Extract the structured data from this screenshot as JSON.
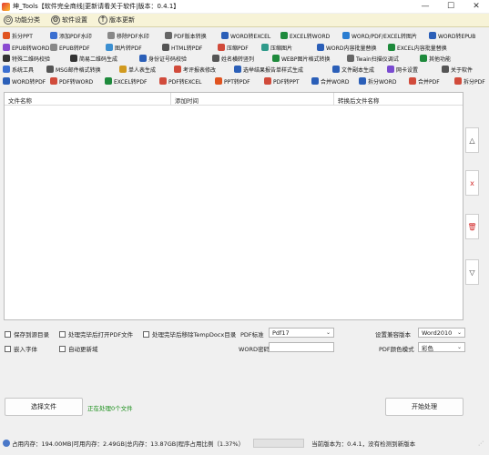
{
  "window": {
    "title": "坤_Tools【软件完全商线|更新请看关于软件|版本：0.4.1】",
    "minimize": "—",
    "maximize": "☐",
    "close": "✕"
  },
  "menu": [
    {
      "label": "功能分类",
      "icon": "⊙"
    },
    {
      "label": "软件设置",
      "icon": "⚙"
    },
    {
      "label": "版本更新",
      "icon": "↑"
    }
  ],
  "toolbar_rows": [
    [
      {
        "label": "拆分PPT",
        "color": "#e0531f"
      },
      {
        "label": "添加PDF水印",
        "color": "#3b6fd1"
      },
      {
        "label": "移除PDF水印",
        "color": "#888888"
      },
      {
        "label": "PDF版本转换",
        "color": "#666666"
      },
      {
        "label": "WORD转EXCEL",
        "color": "#2b5fb8"
      },
      {
        "label": "EXCEL转WORD",
        "color": "#1e8a3c"
      },
      {
        "label": "WORD/PDF/EXCEL转图片",
        "color": "#2a7dd1"
      },
      {
        "label": "WORD转EPUB",
        "color": "#2b5fb8"
      }
    ],
    [
      {
        "label": "EPUB转WORD",
        "color": "#8a4bd1"
      },
      {
        "label": "EPUB转PDF",
        "color": "#888888"
      },
      {
        "label": "图片转PDF",
        "color": "#3b8fd1"
      },
      {
        "label": "HTML转PDF",
        "color": "#555555"
      },
      {
        "label": "压缩PDF",
        "color": "#d14b3b"
      },
      {
        "label": "压缩图片",
        "color": "#2f9a8a"
      },
      {
        "label": "WORD内容批量替换",
        "color": "#2b5fb8"
      },
      {
        "label": "EXCEL内容批量替换",
        "color": "#1e8a3c"
      }
    ],
    [
      {
        "label": "特殊二维码校验",
        "color": "#333333"
      },
      {
        "label": "简易二维码生成",
        "color": "#333333"
      },
      {
        "label": "身份证号码校验",
        "color": "#2b5fb8"
      },
      {
        "label": "姓名横转竖列",
        "color": "#555555"
      },
      {
        "label": "WEBP图片格式转换",
        "color": "#1e8a3c"
      },
      {
        "label": "Twain扫描仪调试",
        "color": "#666666"
      },
      {
        "label": "其他功能",
        "color": "#1e8a3c"
      }
    ],
    [
      {
        "label": "系统工具",
        "color": "#3b6fd1"
      },
      {
        "label": "MSG邮件格式转换",
        "color": "#555555"
      },
      {
        "label": "单人表生成",
        "color": "#d19a1f"
      },
      {
        "label": "考评报表修改",
        "color": "#d14b3b"
      },
      {
        "label": "选举结果报告单样式生成",
        "color": "#2b5fb8"
      },
      {
        "label": "文件副本生成",
        "color": "#2b5fb8"
      },
      {
        "label": "网卡设置",
        "color": "#7a4bd1"
      },
      {
        "label": "关于软件",
        "color": "#555555"
      }
    ],
    [
      {
        "label": "WORD转PDF",
        "color": "#2b5fb8"
      },
      {
        "label": "PDF转WORD",
        "color": "#d14b3b"
      },
      {
        "label": "EXCEL转PDF",
        "color": "#1e8a3c"
      },
      {
        "label": "PDF转EXCEL",
        "color": "#d14b3b"
      },
      {
        "label": "PPT转PDF",
        "color": "#e0531f"
      },
      {
        "label": "PDF转PPT",
        "color": "#d14b3b"
      },
      {
        "label": "合并WORD",
        "color": "#2b5fb8"
      },
      {
        "label": "拆分WORD",
        "color": "#2b5fb8"
      },
      {
        "label": "合并PDF",
        "color": "#d14b3b"
      },
      {
        "label": "拆分PDF",
        "color": "#d14b3b"
      }
    ]
  ],
  "table": {
    "columns": [
      "文件名称",
      "添加时间",
      "转换后文件名称"
    ]
  },
  "side_buttons": [
    {
      "name": "move-up-icon",
      "glyph": "△"
    },
    {
      "name": "remove-icon",
      "glyph": "x",
      "color": "#d32f2f"
    },
    {
      "name": "delete-icon",
      "glyph": "🗑",
      "color": "#d32f2f"
    },
    {
      "name": "move-down-icon",
      "glyph": "▽"
    }
  ],
  "options": {
    "keep_dir": "保存到源目录",
    "open_after": "处理完毕后打开PDF文件",
    "remove_temp": "处理完毕后移除TempDocx目录",
    "embed_font": "嵌入字体",
    "auto_new_domain": "自动更新域",
    "pdf_standard_label": "PDF标准",
    "pdf_standard_value": "Pdf17",
    "word_password_label": "WORD密码",
    "compat_label": "设置兼容版本",
    "compat_value": "Word2010",
    "color_mode_label": "PDF颜色模式",
    "color_mode_value": "彩色"
  },
  "actions": {
    "select_file": "选择文件",
    "processing": "正在处理0个文件",
    "start": "开始处理"
  },
  "status": {
    "memory": "占用内存：194.00MB|可用内存：2.49GB|总内存：13.87GB|程序占用比例（1.37%）",
    "version": "当前版本为：0.4.1，没有检测到新版本"
  }
}
